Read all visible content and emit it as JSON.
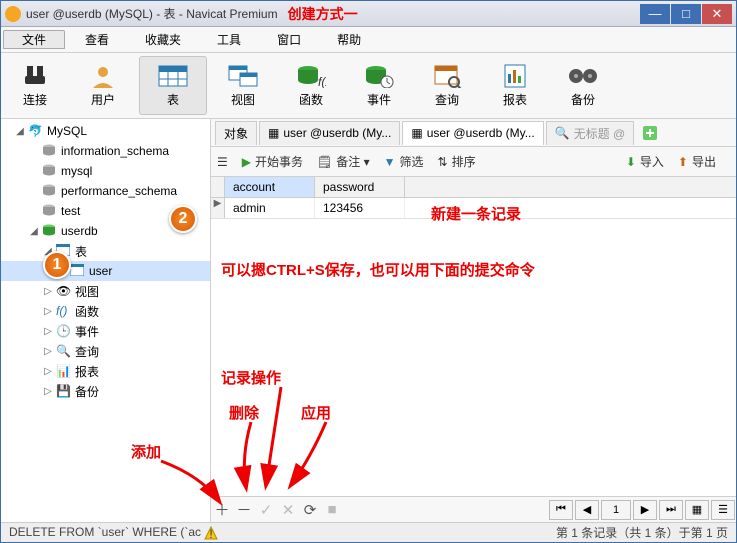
{
  "window": {
    "title": "user @userdb (MySQL) - 表 - Navicat Premium",
    "annotationTitleRight": "创建方式一"
  },
  "menu": {
    "file": "文件",
    "view": "查看",
    "fav": "收藏夹",
    "tools": "工具",
    "window": "窗口",
    "help": "帮助"
  },
  "ribbon": {
    "connect": "连接",
    "user": "用户",
    "table": "表",
    "view": "视图",
    "func": "函数",
    "event": "事件",
    "query": "查询",
    "report": "报表",
    "backup": "备份"
  },
  "tree": {
    "root": "MySQL",
    "dbs": [
      "information_schema",
      "mysql",
      "performance_schema",
      "test"
    ],
    "userdb": "userdb",
    "tablesNode": "表",
    "userTable": "user",
    "viewsNode": "视图",
    "funcNode": "函数",
    "eventNode": "事件",
    "queryNode": "查询",
    "reportNode": "报表",
    "backupNode": "备份"
  },
  "tabs": {
    "t0": "对象",
    "t1": "user @userdb (My...",
    "t2": "user @userdb (My...",
    "t3": "无标题 @"
  },
  "toolbar2": {
    "begin": "开始事务",
    "note": "备注 ▾",
    "filter": "筛选",
    "sort": "排序",
    "import": "导入",
    "export": "导出"
  },
  "gridHeaders": {
    "c0": "account",
    "c1": "password"
  },
  "row0": {
    "c0": "admin",
    "c1": "123456"
  },
  "annotations": {
    "newRecord": "新建一条记录",
    "saveHint": "可以摁CTRL+S保存，也可以用下面的提交命令",
    "recordOps": "记录操作",
    "add": "添加",
    "delete": "删除",
    "apply": "应用"
  },
  "footer": {
    "pageInput": "1"
  },
  "statusbar": {
    "sql": "DELETE FROM `user` WHERE (`ac",
    "recinfo": "第 1 条记录（共 1 条）于第 1 页"
  },
  "markers": {
    "m1": "1",
    "m2": "2"
  }
}
